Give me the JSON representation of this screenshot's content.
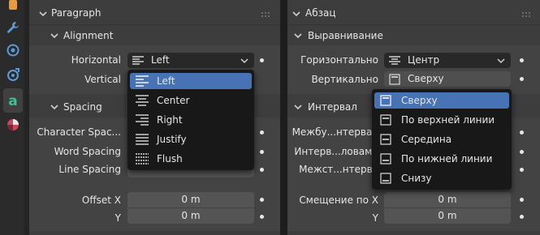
{
  "colors": {
    "accent": "#4772b3",
    "panel": "#3d3d3d",
    "field": "#545454",
    "menu": "#181818"
  },
  "toolstrip": {
    "icons": [
      "object-data-icon",
      "wrench-icon",
      "physics-icon",
      "constraint-icon",
      "text-data-icon",
      "material-icon"
    ]
  },
  "en": {
    "panel_title": "Paragraph",
    "alignment_title": "Alignment",
    "horizontal_label": "Horizontal",
    "horizontal_value": "Left",
    "vertical_label": "Vertical",
    "spacing_title": "Spacing",
    "character_spacing_label": "Character Spac...",
    "word_spacing_label": "Word Spacing",
    "line_spacing_label": "Line Spacing",
    "offset_x_label": "Offset X",
    "offset_x_value": "0 m",
    "offset_y_label": "Y",
    "offset_y_value": "0 m",
    "menu": [
      "Left",
      "Center",
      "Right",
      "Justify",
      "Flush"
    ]
  },
  "ru": {
    "panel_title": "Абзац",
    "alignment_title": "Выравнивание",
    "horizontal_label": "Горизонтально",
    "horizontal_value": "Центр",
    "vertical_label": "Вертикально",
    "vertical_value": "Сверху",
    "spacing_title": "Интервал",
    "character_spacing_label": "Межбу...нтервал",
    "word_spacing_label": "Интерв...ловами",
    "line_spacing_label": "Межст...нтерва",
    "offset_x_label": "Смещение по X",
    "offset_x_value": "0 m",
    "offset_y_label": "Y",
    "offset_y_value": "0 m",
    "menu": [
      "Сверху",
      "По верхней линии",
      "Середина",
      "По нижней линии",
      "Снизу"
    ]
  }
}
